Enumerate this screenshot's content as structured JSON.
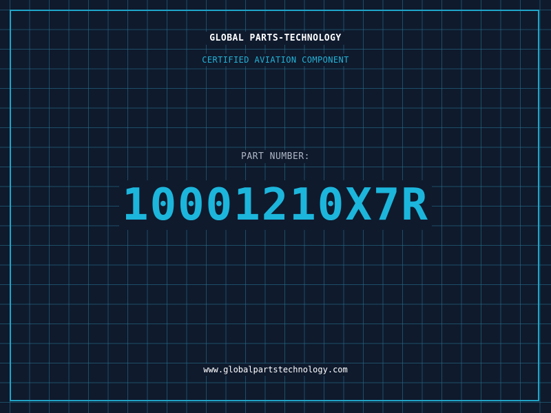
{
  "header": {
    "company_name": "GLOBAL PARTS-TECHNOLOGY",
    "subtitle": "CERTIFIED AVIATION COMPONENT"
  },
  "part": {
    "label": "PART NUMBER:",
    "number": "10001210X7R"
  },
  "footer": {
    "website": "www.globalpartstechnology.com"
  },
  "colors": {
    "background": "#0f1a2d",
    "grid": "#28789a",
    "frame": "#1fa6c9",
    "accent": "#1cb6dc",
    "text": "#ffffff",
    "muted_text": "#aeb7c4"
  }
}
